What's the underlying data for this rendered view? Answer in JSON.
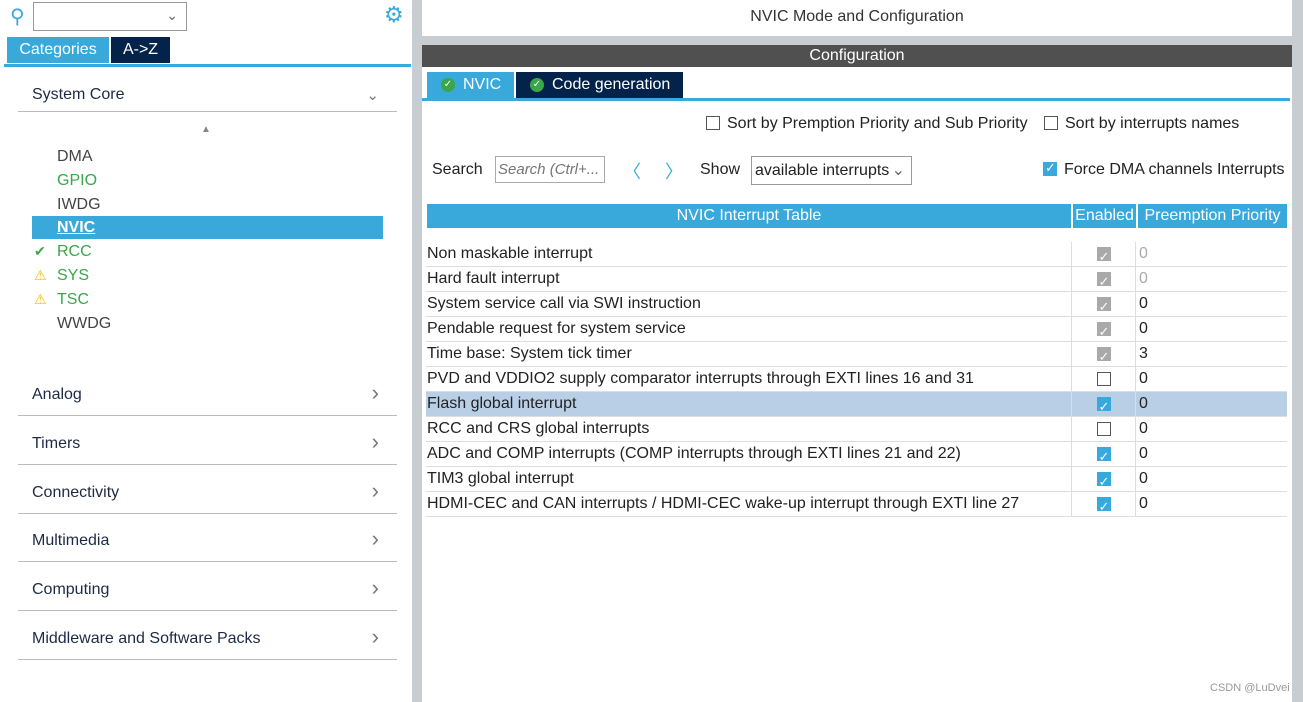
{
  "left": {
    "search_value": "",
    "tabs": [
      "Categories",
      "A->Z"
    ],
    "system_core": "System Core",
    "items": [
      {
        "label": "DMA",
        "status": ""
      },
      {
        "label": "GPIO",
        "status": ""
      },
      {
        "label": "IWDG",
        "status": ""
      },
      {
        "label": "NVIC",
        "status": "selected"
      },
      {
        "label": "RCC",
        "status": "ok"
      },
      {
        "label": "SYS",
        "status": "warning"
      },
      {
        "label": "TSC",
        "status": "warning"
      },
      {
        "label": "WWDG",
        "status": ""
      }
    ],
    "sections": [
      "Analog",
      "Timers",
      "Connectivity",
      "Multimedia",
      "Computing",
      "Middleware and Software Packs"
    ]
  },
  "right": {
    "title": "NVIC Mode and Configuration",
    "config_label": "Configuration",
    "tabs": [
      "NVIC",
      "Code generation"
    ],
    "sort_premption": "Sort by Premption Priority and Sub Priority",
    "sort_names": "Sort by interrupts names",
    "search_label": "Search",
    "search_placeholder": "Search (Ctrl+...",
    "show_label": "Show",
    "show_value": "available interrupts",
    "force_dma": "Force DMA channels Interrupts",
    "force_dma_checked": true,
    "table": {
      "headers": [
        "NVIC Interrupt Table",
        "Enabled",
        "Preemption Priority"
      ],
      "rows": [
        {
          "name": "Non maskable interrupt",
          "enabled": "locked",
          "priority": "0"
        },
        {
          "name": "Hard fault interrupt",
          "enabled": "locked",
          "priority": "0"
        },
        {
          "name": "System service call via SWI instruction",
          "enabled": "locked",
          "priority": "0"
        },
        {
          "name": "Pendable request for system service",
          "enabled": "locked",
          "priority": "0"
        },
        {
          "name": "Time base: System tick timer",
          "enabled": "locked",
          "priority": "3"
        },
        {
          "name": "PVD and VDDIO2 supply comparator interrupts through EXTI lines 16 and 31",
          "enabled": "off",
          "priority": "0"
        },
        {
          "name": "Flash global interrupt",
          "enabled": "on",
          "priority": "0",
          "highlighted": true
        },
        {
          "name": "RCC and CRS global interrupts",
          "enabled": "off",
          "priority": "0"
        },
        {
          "name": "ADC and COMP interrupts (COMP interrupts through EXTI lines 21 and 22)",
          "enabled": "on",
          "priority": "0"
        },
        {
          "name": "TIM3 global interrupt",
          "enabled": "on",
          "priority": "0"
        },
        {
          "name": "HDMI-CEC and CAN interrupts / HDMI-CEC wake-up interrupt through EXTI line 27",
          "enabled": "on",
          "priority": "0"
        }
      ]
    }
  },
  "watermark": "CSDN @LuDvei",
  "colors": {
    "accent": "#39a9dc",
    "dark_tab": "#03234b",
    "ok": "#3aa64a",
    "warning": "#f2c200"
  }
}
